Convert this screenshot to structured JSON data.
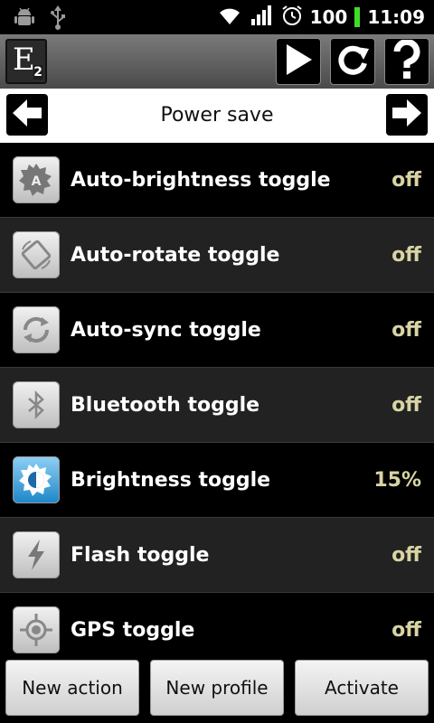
{
  "status_bar": {
    "left_icons": [
      "android-debug-icon",
      "usb-icon"
    ],
    "right_icons": [
      "wifi-icon",
      "signal-icon",
      "alarm-icon"
    ],
    "battery_level": "100",
    "time": "11:09",
    "battery_color": "#3fdc2a"
  },
  "toolbar": {
    "logo_letter": "E",
    "logo_sub": "2",
    "buttons": [
      "play-icon",
      "refresh-icon",
      "help-icon"
    ]
  },
  "profile": {
    "title": "Power save",
    "prev_icon": "arrow-left-icon",
    "next_icon": "arrow-right-icon"
  },
  "actions": [
    {
      "label": "Auto-brightness toggle",
      "value": "off",
      "icon": "auto-brightness-icon"
    },
    {
      "label": "Auto-rotate toggle",
      "value": "off",
      "icon": "rotate-icon"
    },
    {
      "label": "Auto-sync toggle",
      "value": "off",
      "icon": "sync-icon"
    },
    {
      "label": "Bluetooth toggle",
      "value": "off",
      "icon": "bluetooth-icon"
    },
    {
      "label": "Brightness toggle",
      "value": "15%",
      "icon": "brightness-icon"
    },
    {
      "label": "Flash toggle",
      "value": "off",
      "icon": "flash-icon"
    },
    {
      "label": "GPS toggle",
      "value": "off",
      "icon": "gps-icon"
    }
  ],
  "bottom_buttons": {
    "new_action": "New action",
    "new_profile": "New profile",
    "activate": "Activate"
  },
  "colors": {
    "value_text": "#d8d4a4",
    "row_alt": "#222222",
    "brightness_icon": "#1c86c9"
  }
}
